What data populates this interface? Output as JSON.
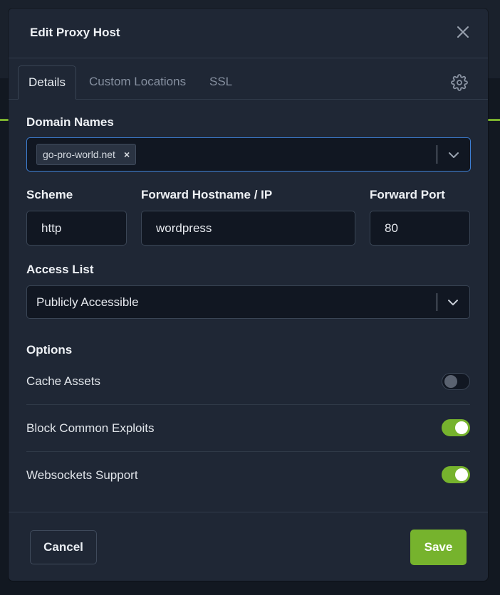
{
  "modal": {
    "title": "Edit Proxy Host"
  },
  "tabs": [
    {
      "label": "Details",
      "active": true
    },
    {
      "label": "Custom Locations",
      "active": false
    },
    {
      "label": "SSL",
      "active": false
    }
  ],
  "icons": {
    "close": "close-icon",
    "settings": "gear-icon",
    "dropdown": "chevron-down-icon",
    "remove_tag": "remove-tag-icon"
  },
  "domain_names": {
    "label": "Domain Names",
    "tags": [
      "go-pro-world.net"
    ],
    "tag_remove": "×"
  },
  "scheme": {
    "label": "Scheme",
    "value": "http"
  },
  "forward_host": {
    "label": "Forward Hostname / IP",
    "value": "wordpress"
  },
  "forward_port": {
    "label": "Forward Port",
    "value": "80"
  },
  "access_list": {
    "label": "Access List",
    "value": "Publicly Accessible"
  },
  "options": {
    "heading": "Options",
    "items": [
      {
        "label": "Cache Assets",
        "enabled": false
      },
      {
        "label": "Block Common Exploits",
        "enabled": true
      },
      {
        "label": "Websockets Support",
        "enabled": true
      }
    ]
  },
  "footer": {
    "cancel_label": "Cancel",
    "save_label": "Save"
  },
  "colors": {
    "accent_green": "#76b32d",
    "focus_blue": "#3d7fd4",
    "modal_bg": "#1f2735",
    "input_bg": "#111722"
  }
}
